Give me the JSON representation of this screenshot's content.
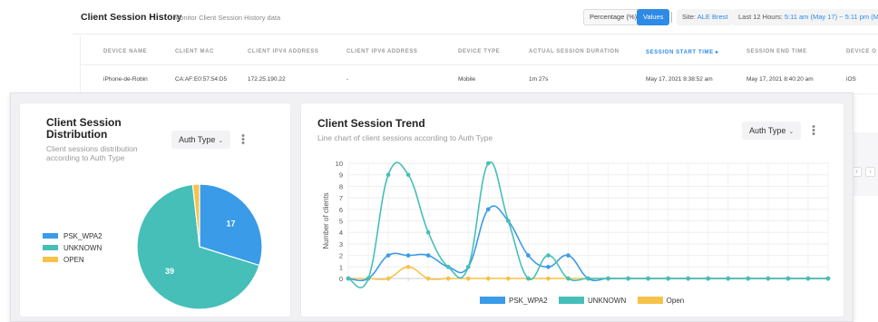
{
  "background_page": {
    "title": "Client Session History",
    "subtitle": "Monitor Client Session History data",
    "toggle": {
      "percentage_label": "Percentage (%)",
      "values_label": "Values",
      "active": "Values"
    },
    "site_filter": {
      "label": "Site:",
      "value": "ALE Brest"
    },
    "time_filter": {
      "label": "Last 12 Hours:",
      "value": "5:11 am (May 17) ~ 5:11 pm (May 17)"
    },
    "table": {
      "columns": [
        "DEVICE NAME",
        "CLIENT MAC",
        "CLIENT IPV4 ADDRESS",
        "CLIENT IPV6 ADDRESS",
        "DEVICE TYPE",
        "ACTUAL SESSION DURATION",
        "SESSION START TIME ▸",
        "SESSION END TIME",
        "DEVICE O"
      ],
      "rows": [
        [
          "iPhone-de-Robin",
          "CA:AF:E0:57:54:D5",
          "172.25.190.22",
          "-",
          "Mobile",
          "1m 27s",
          "May 17, 2021 8:38:52 am",
          "May 17, 2021 8:40:20 am",
          "iOS"
        ]
      ]
    },
    "pager": {
      "prev": "‹",
      "next": "›"
    }
  },
  "distribution_card": {
    "title_line1": "Client Session",
    "title_line2": "Distribution",
    "subtitle_line1": "Client sessions distribution",
    "subtitle_line2": "according to Auth Type",
    "dropdown": "Auth Type",
    "kebab_icon": "more-vertical-icon",
    "legend": [
      "PSK_WPA2",
      "UNKNOWN",
      "OPEN"
    ],
    "slice_labels": [
      "17",
      "39"
    ]
  },
  "trend_card": {
    "title": "Client Session Trend",
    "subtitle": "Line chart of client sessions according to Auth Type",
    "dropdown": "Auth Type",
    "kebab_icon": "more-vertical-icon",
    "legend": [
      "PSK_WPA2",
      "UNKNOWN",
      "Open"
    ]
  },
  "colors": {
    "psk": "#3a9be8",
    "unknown": "#45bfb8",
    "open": "#f7c24a",
    "accent": "#2d8ae6"
  },
  "chart_data": [
    {
      "type": "pie",
      "categories": [
        "PSK_WPA2",
        "UNKNOWN",
        "OPEN"
      ],
      "values": [
        17,
        39,
        1
      ],
      "legend": "left"
    },
    {
      "type": "line",
      "x": [
        0,
        1,
        2,
        3,
        4,
        5,
        6,
        7,
        8,
        9,
        10,
        11,
        12,
        13,
        14,
        15,
        16,
        17,
        18,
        19,
        20,
        21,
        22,
        23,
        24
      ],
      "series": [
        {
          "name": "PSK_WPA2",
          "values": [
            0,
            0,
            2,
            2,
            2,
            1,
            1,
            6,
            5,
            2,
            1,
            2,
            0,
            0,
            0,
            0,
            0,
            0,
            0,
            0,
            0,
            0,
            0,
            0,
            0
          ]
        },
        {
          "name": "UNKNOWN",
          "values": [
            0,
            0,
            9,
            9,
            4,
            1,
            1,
            10,
            5,
            0,
            2,
            0,
            0,
            0,
            0,
            0,
            0,
            0,
            0,
            0,
            0,
            0,
            0,
            0,
            0
          ]
        },
        {
          "name": "Open",
          "values": [
            0,
            0,
            0,
            1,
            0,
            0,
            0,
            0,
            0,
            0,
            0,
            0,
            0,
            0,
            0,
            0,
            0,
            0,
            0,
            0,
            0,
            0,
            0,
            0,
            0
          ]
        }
      ],
      "ylabel": "Number of clients",
      "ylim": [
        0,
        10
      ],
      "yticks": [
        "0",
        "1",
        "2",
        "3",
        "4",
        "5",
        "6",
        "7",
        "8",
        "9",
        "10"
      ],
      "grid": true,
      "legend": "bottom"
    }
  ]
}
